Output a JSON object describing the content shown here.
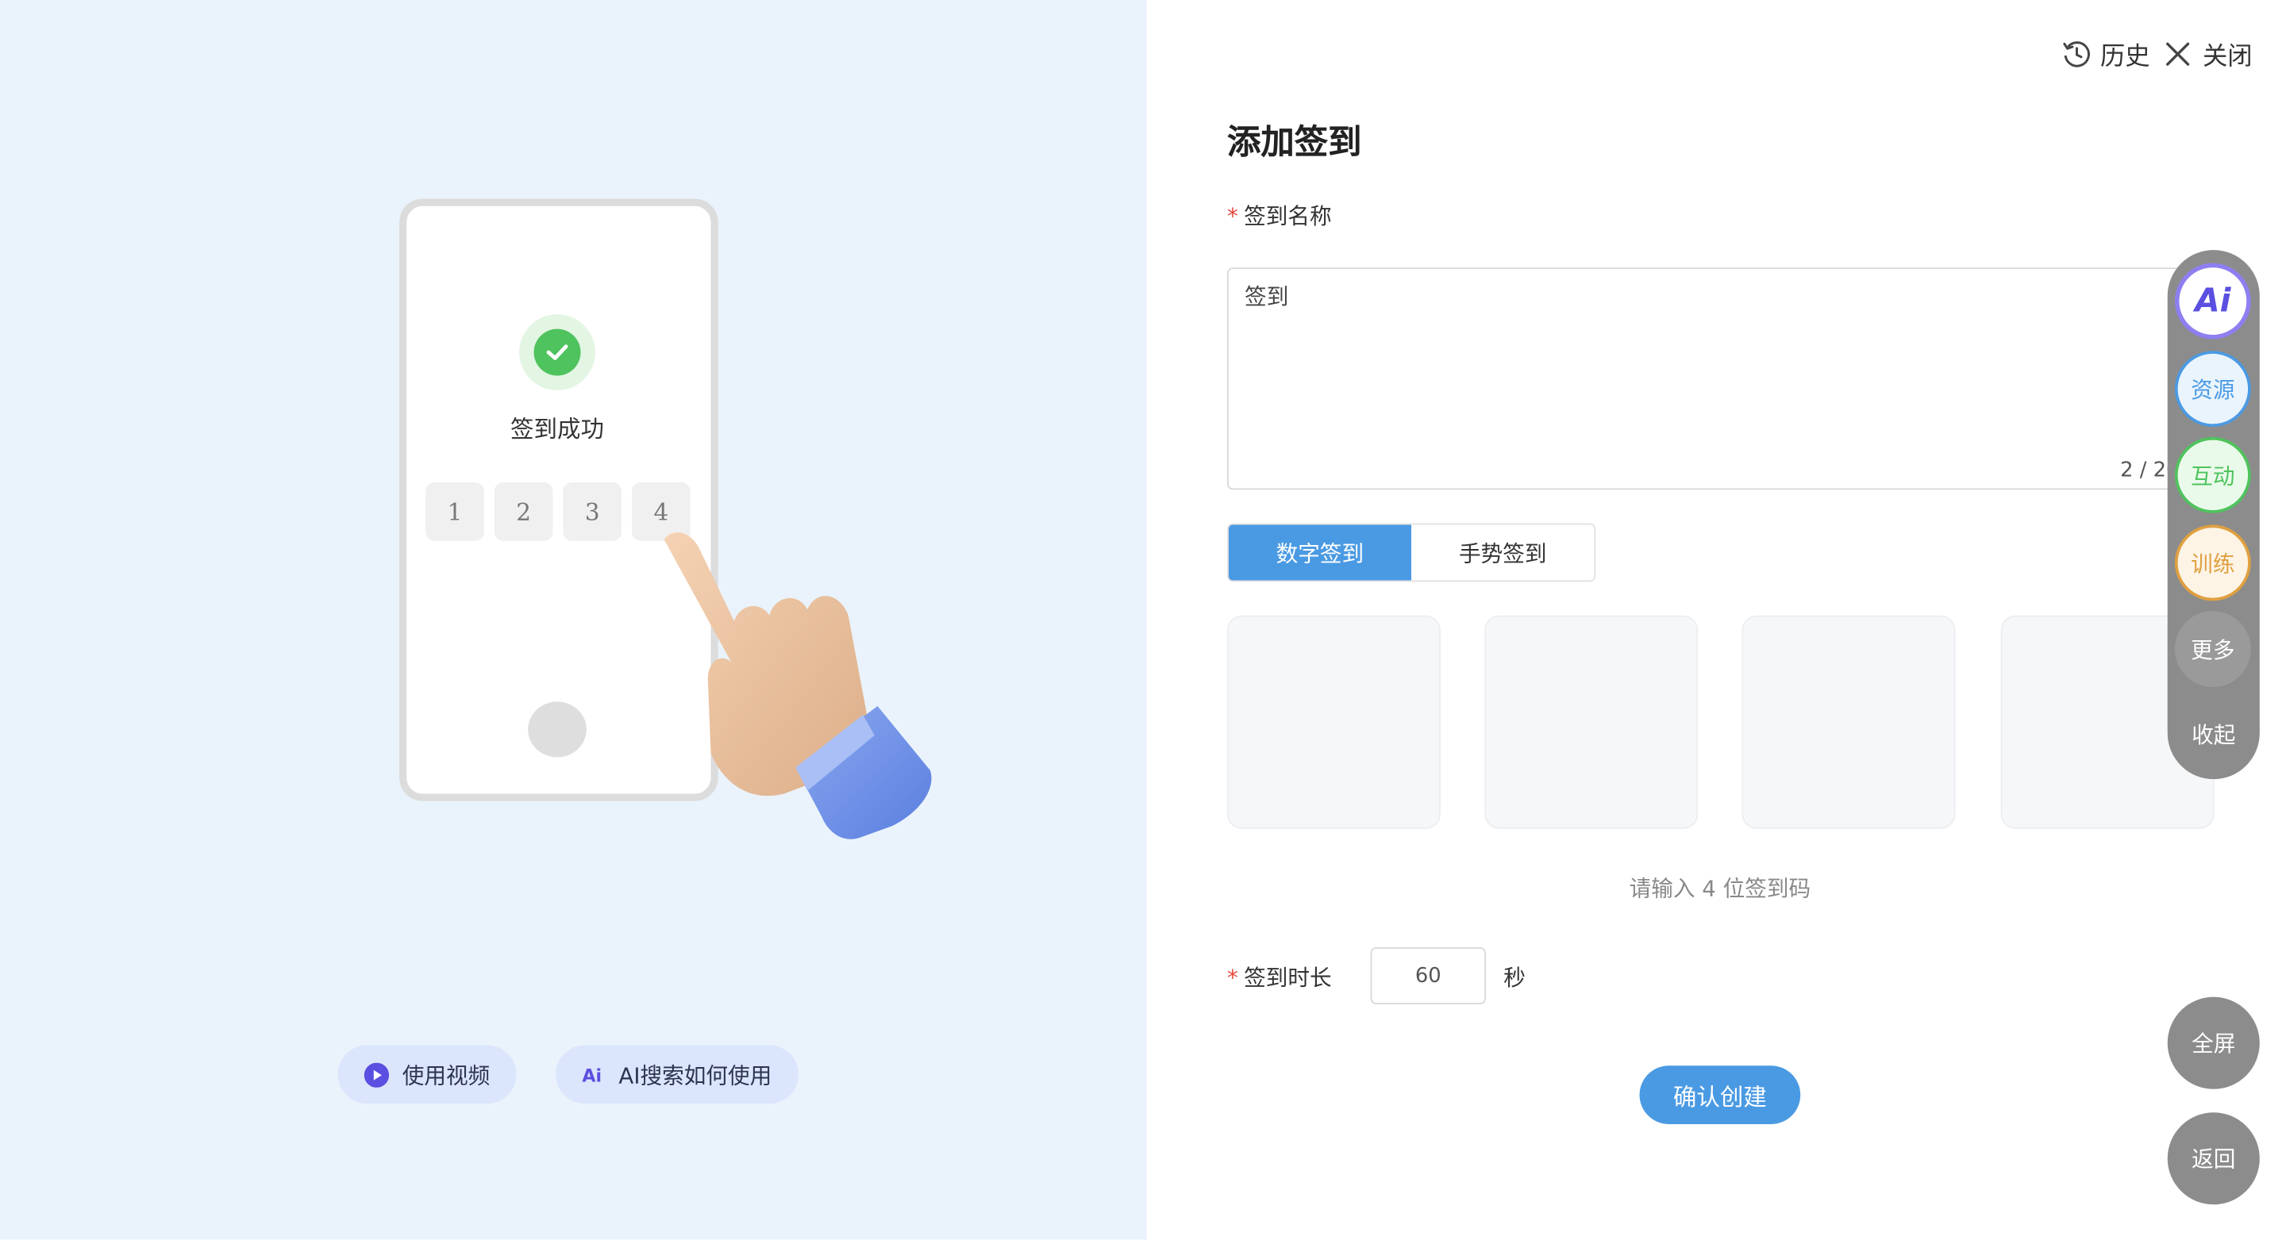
{
  "left": {
    "success_text": "签到成功",
    "digits": [
      "1",
      "2",
      "3",
      "4"
    ],
    "video_button": "使用视频",
    "ai_search_button": "AI搜索如何使用"
  },
  "topbar": {
    "history_label": "历史",
    "close_label": "关闭"
  },
  "form": {
    "title": "添加签到",
    "name_label": "签到名称",
    "name_value": "签到",
    "name_counter": "2 / 20",
    "tabs": [
      {
        "label": "数字签到",
        "active": true
      },
      {
        "label": "手势签到",
        "active": false
      }
    ],
    "code_hint": "请输入 4 位签到码",
    "duration_label": "签到时长",
    "duration_value": "60",
    "duration_unit": "秒",
    "confirm_button": "确认创建"
  },
  "dock": {
    "ai_label": "Ai",
    "items": [
      {
        "label": "资源",
        "color": "#4a9ae3"
      },
      {
        "label": "互动",
        "color": "#4fc35d"
      },
      {
        "label": "训练",
        "color": "#e0a040"
      },
      {
        "label": "更多",
        "color": "#ffffff"
      }
    ],
    "collapse_label": "收起"
  },
  "fullscreen_button": "全屏",
  "back_button": "返回",
  "colors": {
    "accent": "#4a9ae3",
    "success": "#4fc35d",
    "left_bg": "#eaf3fc",
    "required": "#e5483b"
  }
}
